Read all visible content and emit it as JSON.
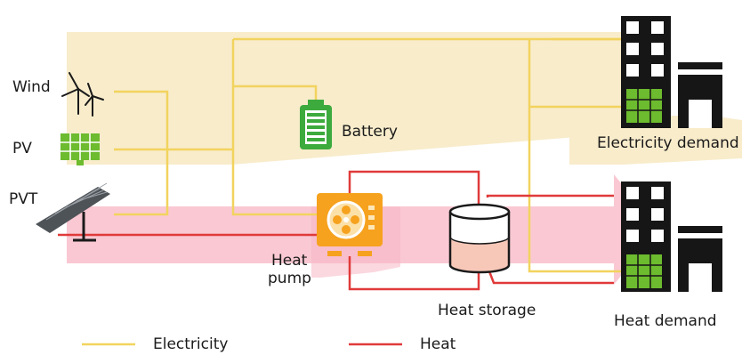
{
  "labels": {
    "wind": "Wind",
    "pv": "PV",
    "pvt": "PVT",
    "battery": "Battery",
    "heat_pump_line1": "Heat",
    "heat_pump_line2": "pump",
    "heat_storage": "Heat storage",
    "electricity_demand": "Electricity demand",
    "heat_demand": "Heat demand"
  },
  "legend": {
    "electricity": "Electricity",
    "heat": "Heat"
  },
  "colors": {
    "electricity": "#f2d35e",
    "heat": "#e03a3a",
    "electricity_band": "#f8eccb",
    "heat_band": "#f9c8d2",
    "battery": "#3daa3d",
    "pv_panel": "#6dbb2e",
    "heat_pump": "#f6a21e",
    "building": "#161616",
    "water": "#f7c7b8"
  }
}
